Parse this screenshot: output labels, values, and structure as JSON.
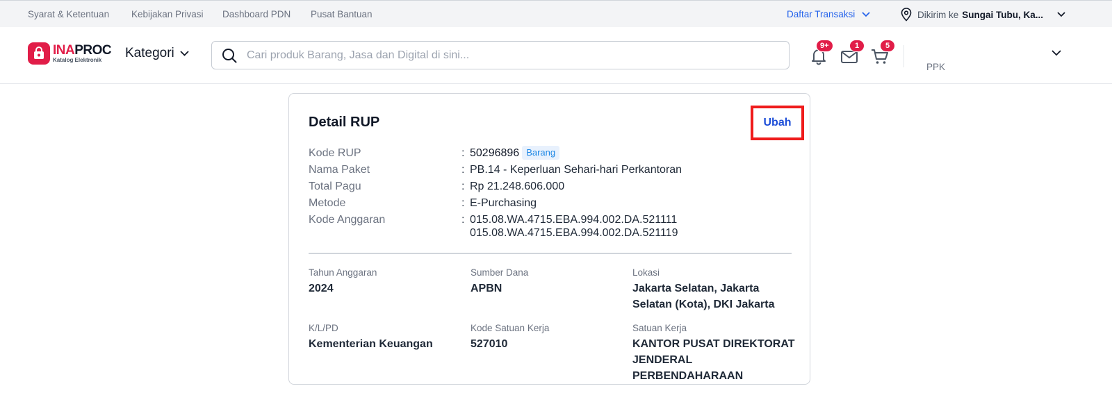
{
  "topbar": {
    "links": [
      "Syarat & Ketentuan",
      "Kebijakan Privasi",
      "Dashboard PDN",
      "Pusat Bantuan"
    ],
    "transactions_label": "Daftar Transaksi",
    "ship_label": "Dikirim ke",
    "ship_value": "Sungai Tubu, Ka..."
  },
  "header": {
    "logo_brand_a": "INA",
    "logo_brand_b": "PROC",
    "logo_sub": "Katalog Elektronik",
    "kategori_label": "Kategori",
    "search_placeholder": "Cari produk Barang, Jasa dan Digital di sini...",
    "notif_count": "9+",
    "message_count": "1",
    "cart_count": "5",
    "user_role": "PPK"
  },
  "card": {
    "title": "Detail RUP",
    "edit_label": "Ubah",
    "details": {
      "kode_rup_label": "Kode RUP",
      "kode_rup_value": "50296896",
      "kode_rup_tag": "Barang",
      "nama_paket_label": "Nama Paket",
      "nama_paket_value": "PB.14 - Keperluan Sehari-hari Perkantoran",
      "total_pagu_label": "Total Pagu",
      "total_pagu_value": "Rp 21.248.606.000",
      "metode_label": "Metode",
      "metode_value": "E-Purchasing",
      "kode_anggaran_label": "Kode Anggaran",
      "kode_anggaran_values": [
        "015.08.WA.4715.EBA.994.002.DA.521111",
        "015.08.WA.4715.EBA.994.002.DA.521119"
      ]
    },
    "info": {
      "tahun_label": "Tahun Anggaran",
      "tahun_value": "2024",
      "sumber_label": "Sumber Dana",
      "sumber_value": "APBN",
      "lokasi_label": "Lokasi",
      "lokasi_value": "Jakarta Selatan, Jakarta Selatan (Kota), DKI Jakarta",
      "klpd_label": "K/L/PD",
      "klpd_value": "Kementerian Keuangan",
      "satker_kode_label": "Kode Satuan Kerja",
      "satker_kode_value": "527010",
      "satker_label": "Satuan Kerja",
      "satker_value": "KANTOR PUSAT DIREKTORAT JENDERAL PERBENDAHARAAN"
    }
  },
  "colors": {
    "brand": "#e11d48",
    "link_blue": "#1d4ed8",
    "highlight_box": "#ef1c1c",
    "tag_blue": "#1e88e5"
  }
}
